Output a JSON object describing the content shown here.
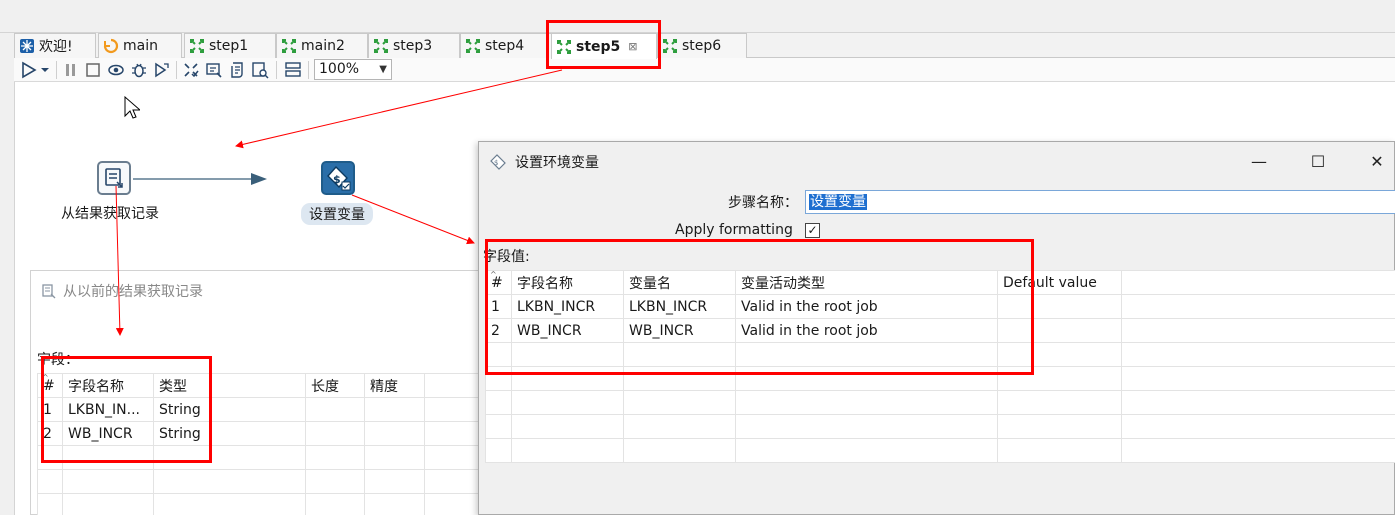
{
  "tabs": [
    {
      "label": "欢迎!",
      "icon": "welcome-icon"
    },
    {
      "label": "main",
      "icon": "job-icon"
    },
    {
      "label": "step1",
      "icon": "transformation-icon"
    },
    {
      "label": "main2",
      "icon": "transformation-icon"
    },
    {
      "label": "step3",
      "icon": "transformation-icon"
    },
    {
      "label": "step4",
      "icon": "transformation-icon"
    },
    {
      "label": "step5",
      "icon": "transformation-icon",
      "active": true,
      "close": "⊠"
    },
    {
      "label": "step6",
      "icon": "transformation-icon"
    }
  ],
  "toolbar": {
    "zoom_value": "100%",
    "icons": [
      "run-icon",
      "run-dropdown-icon",
      "pause-icon",
      "stop-icon",
      "preview-icon",
      "debug-icon",
      "replay-icon",
      "verify-icon",
      "impact-icon",
      "sql-icon",
      "explore-db-icon",
      "get-fields-icon",
      "show-results-icon"
    ]
  },
  "canvas": {
    "nodes": [
      {
        "label": "从结果获取记录",
        "icon": "get-rows-from-result-icon"
      },
      {
        "label": "设置变量",
        "icon": "set-variables-icon",
        "selected": true
      }
    ]
  },
  "left_panel": {
    "title": "从以前的结果获取记录",
    "fields_label": "字段：",
    "columns": [
      "#",
      "字段名称",
      "类型",
      "长度",
      "精度"
    ],
    "rows": [
      [
        "1",
        "LKBN_IN...",
        "String",
        "",
        ""
      ],
      [
        "2",
        "WB_INCR",
        "String",
        "",
        ""
      ]
    ]
  },
  "dialog": {
    "title": "设置环境变量",
    "step_name_label": "步骤名称：",
    "step_name_value": "设置变量",
    "apply_formatting_label": "Apply formatting",
    "apply_formatting_checked": "✓",
    "fields_label": "字段值:",
    "columns": [
      "#",
      "字段名称",
      "变量名",
      "变量活动类型",
      "Default value"
    ],
    "rows": [
      [
        "1",
        "LKBN_INCR",
        "LKBN_INCR",
        "Valid in the root job",
        ""
      ],
      [
        "2",
        "WB_INCR",
        "WB_INCR",
        "Valid in the root job",
        ""
      ]
    ],
    "window_buttons": {
      "minimize": "—",
      "maximize": "☐",
      "close": "✕"
    }
  },
  "colors": {
    "annotation_red": "#ff0000",
    "selection_blue": "#1e6fd0",
    "hop_arrow": "#3a5f7a",
    "tab_icon_green": "#2e9e3e"
  }
}
